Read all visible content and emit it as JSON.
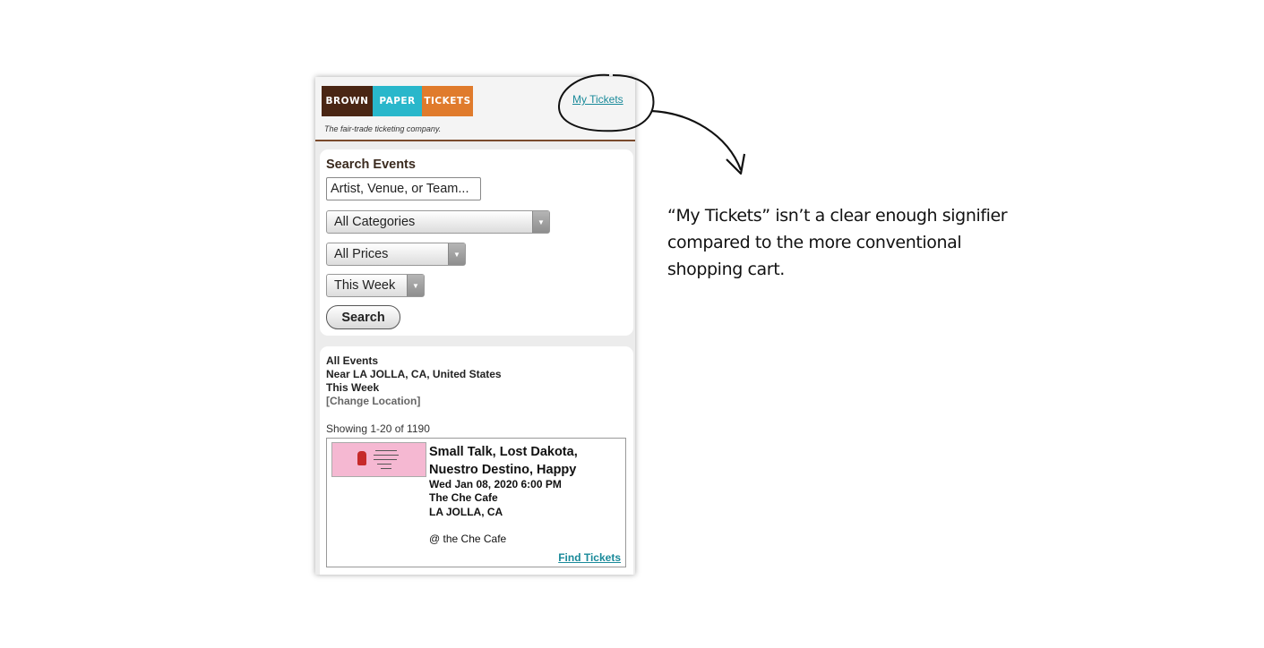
{
  "header": {
    "logo": [
      "BROWN",
      "PAPER",
      "TICKETS"
    ],
    "tagline": "The fair-trade ticketing company.",
    "my_tickets": "My Tickets"
  },
  "search": {
    "title": "Search Events",
    "input_value": "Artist, Venue, or Team...",
    "category": "All Categories",
    "price": "All Prices",
    "date": "This Week",
    "button": "Search"
  },
  "results": {
    "filter": "All Events",
    "location": "Near LA JOLLA, CA, United States",
    "period": "This Week",
    "change_location": "[Change Location]",
    "showing": "Showing 1-20 of 1190",
    "event": {
      "title": "Small Talk, Lost Dakota, Nuestro Destino, Happy",
      "datetime": "Wed Jan 08, 2020 6:00 PM",
      "venue": "The Che Cafe",
      "city": "LA JOLLA, CA",
      "note": "@ the Che Cafe",
      "cta": "Find Tickets"
    }
  },
  "annotation": "“My Tickets” isn’t a clear enough signifier compared to the more conventional shopping cart.",
  "colors": {
    "brown": "#4a2614",
    "paper": "#29b7cb",
    "tickets": "#e07b2c",
    "link": "#1a8a9a"
  }
}
